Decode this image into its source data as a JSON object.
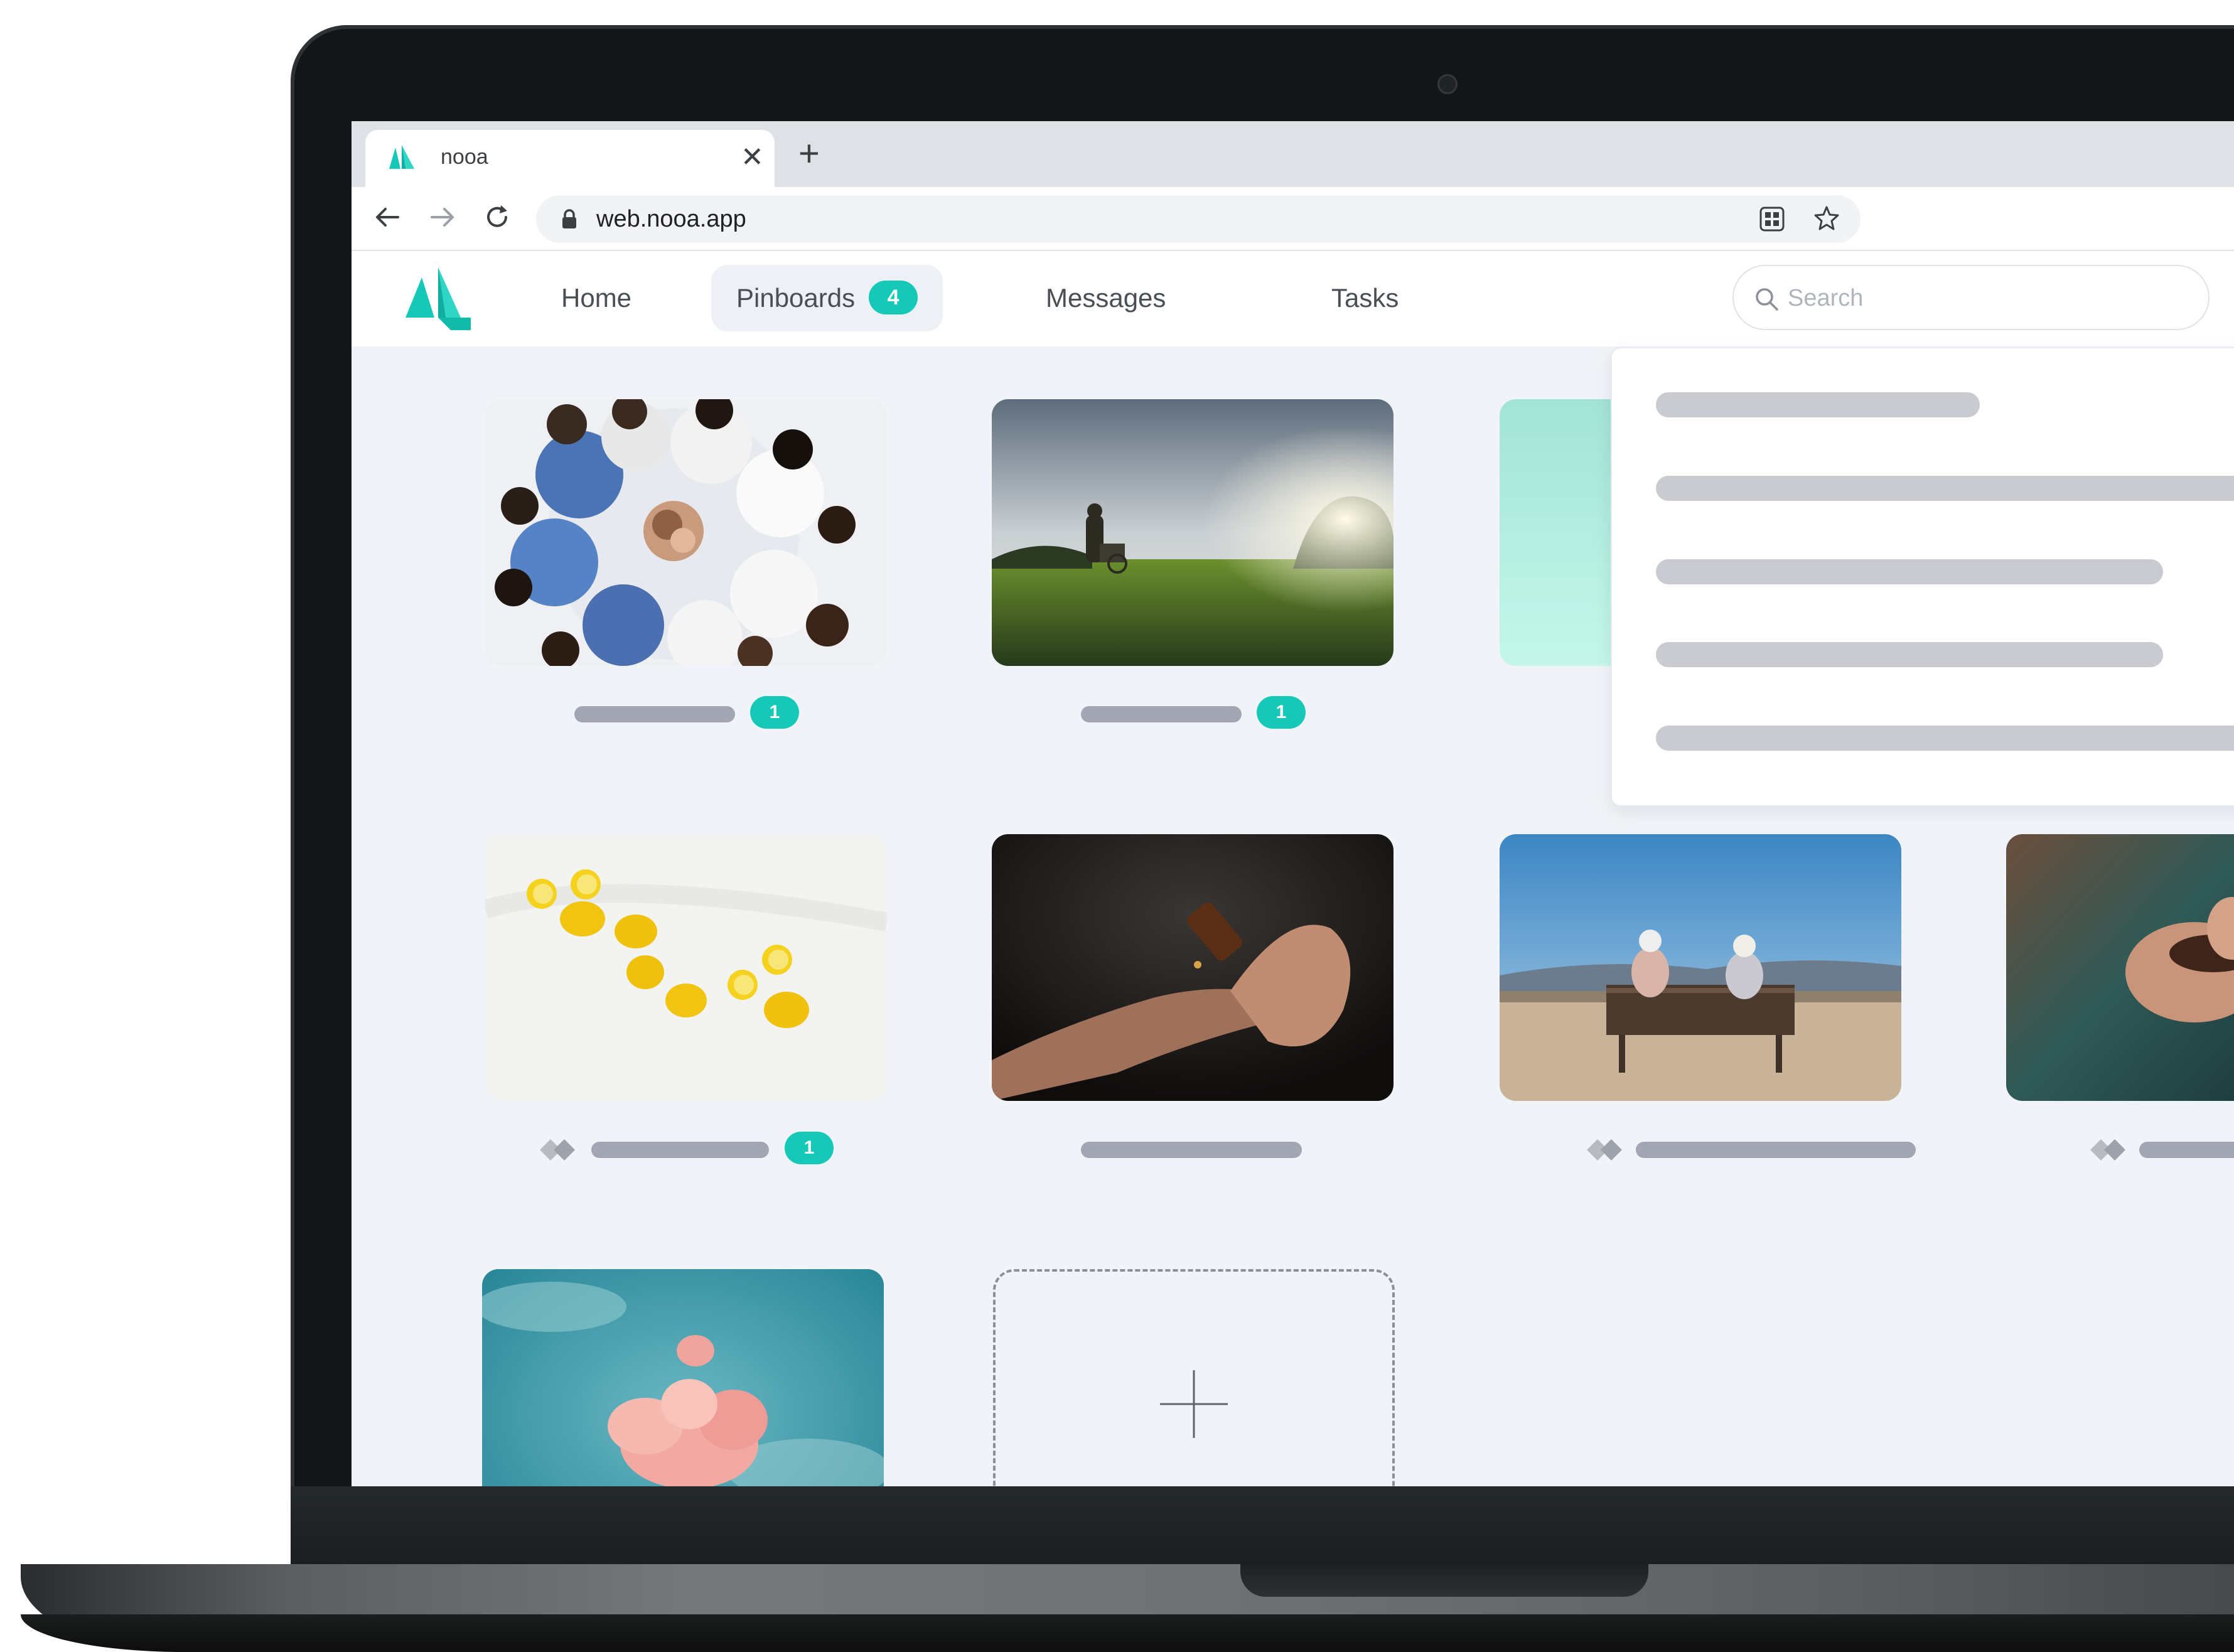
{
  "browser": {
    "tab_title": "nooa",
    "url": "web.nooa.app"
  },
  "nav": {
    "items": [
      {
        "label": "Home"
      },
      {
        "label": "Pinboards",
        "badge": "4",
        "active": true
      },
      {
        "label": "Messages"
      },
      {
        "label": "Tasks"
      }
    ],
    "search_placeholder": "Search"
  },
  "pinboards": [
    {
      "image": "team-hands-photo",
      "count": "1"
    },
    {
      "image": "park-wheelchair-photo",
      "count": "1"
    },
    {
      "image": "lemons-photo",
      "count": "1",
      "shared_icon": true
    },
    {
      "image": "dropper-hands-photo"
    },
    {
      "image": "bench-couple-photo",
      "shared_icon": true
    },
    {
      "image": "elderly-hands-photo",
      "shared_icon": true
    },
    {
      "image": "sky-cloud-photo"
    }
  ],
  "colors": {
    "brand": "#16c8b8",
    "background": "#f0f3f7",
    "label_placeholder": "#a2a6b3"
  }
}
